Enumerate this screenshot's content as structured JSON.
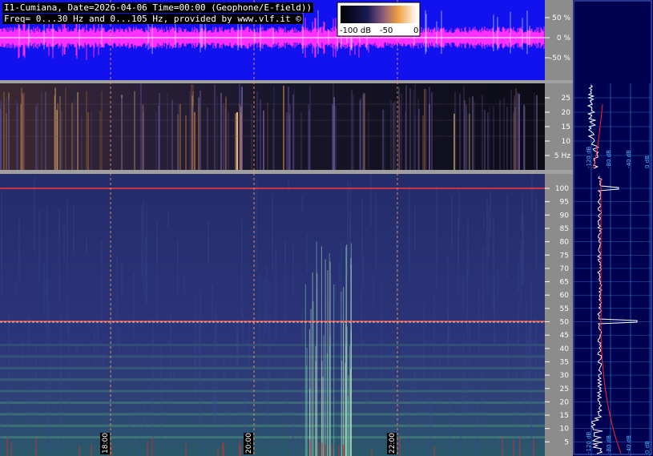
{
  "header": {
    "line1": "I1-Cumiana, Date=2026-04-06 Time=00:00 (Geophone/E-field))",
    "line2": "Freq= 0...30 Hz and 0...105 Hz, provided by www.vlf.it ©"
  },
  "chart_data": [
    {
      "type": "line",
      "title": "",
      "description_role": "waveform amplitude strip",
      "y_ticks": [
        "50 %",
        "0 %",
        "-50 %"
      ],
      "colors": {
        "background": "#1010f0",
        "trace": "#ff30ff",
        "center": "#ffffff"
      }
    },
    {
      "type": "heatmap",
      "description_role": "low-frequency spectrogram",
      "freq_range": [
        0,
        30
      ],
      "y_ticks": [
        "25",
        "20",
        "15",
        "10",
        "5 Hz"
      ],
      "colorbar": {
        "ticks": [
          "-100 dB",
          "-50",
          "0"
        ],
        "range_db": [
          -100,
          0
        ]
      }
    },
    {
      "type": "heatmap",
      "description_role": "spectrogram 0-105 Hz",
      "freq_range": [
        0,
        105
      ],
      "y_ticks": [
        "100",
        "95",
        "90",
        "85",
        "80",
        "75",
        "70",
        "65",
        "60",
        "55",
        "50",
        "45",
        "40",
        "35",
        "30",
        "25",
        "20",
        "15",
        "10",
        "5"
      ],
      "x_ticks": [
        "18:00",
        "20:00",
        "22:00"
      ],
      "mains_lines_hz": [
        50,
        100
      ]
    },
    {
      "type": "line",
      "description_role": "average spectrum panel",
      "x_ticks": [
        "-120 dB",
        "-80 dB",
        "-40 dB",
        "0 dB"
      ],
      "upper_x_ticks": [
        "-120 dB",
        "-80 dB",
        "-40 dB",
        "0 dB"
      ],
      "colors": {
        "spectrum": "#ffffff",
        "reference": "#ff2020",
        "grid": "#3fb0ff"
      }
    }
  ]
}
